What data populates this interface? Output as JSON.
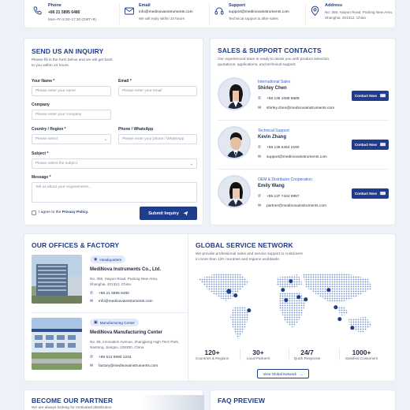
{
  "topbar": {
    "items": [
      {
        "icon": "phone-icon",
        "title": "Phone",
        "line1": "+86 21 5895 6480",
        "line2": "Mon–Fri 8:30–17:30 (GMT+8)"
      },
      {
        "icon": "mail-icon",
        "title": "Email",
        "line1": "info@medinovainstruments.com",
        "line2": "We will reply within 24 hours"
      },
      {
        "icon": "headset-icon",
        "title": "Support",
        "line1": "support@medinovainstruments.com",
        "line2": "Technical support & after-sales"
      },
      {
        "icon": "location-pin-icon",
        "title": "Address",
        "line1": "No. 355, Haiyun Road, Pudong New Area,",
        "line2": "Shanghai, 201312, China"
      }
    ]
  },
  "inquiry": {
    "title": "SEND US AN INQUIRY",
    "intro1": "Please fill in the form below and we will get back",
    "intro2": "to you within 24 hours.",
    "name_label": "Your Name *",
    "name_ph": "Please enter your name",
    "email_label": "Email *",
    "email_ph": "Please enter your email",
    "company_label": "Company",
    "company_ph": "Please enter your company",
    "country_label": "Country / Region *",
    "country_value": "Please select",
    "phone_label": "Phone / WhatsApp",
    "phone_ph": "Please enter your phone / WhatsApp",
    "subject_label": "Subject *",
    "subject_value": "Please select the subject",
    "message_label": "Message *",
    "message_ph": "Tell us about your requirements...",
    "agree_prefix": "I agree to the",
    "agree_link": "Privacy Policy.",
    "submit": "Submit Inquiry"
  },
  "contacts": {
    "title": "SALES & SUPPORT CONTACTS",
    "intro1": "Our experienced team is ready to assist you with product selection,",
    "intro2": "quotations, applications, and technical support.",
    "button": "Contact Now",
    "people": [
      {
        "role": "International Sales",
        "name": "Shirley Chen",
        "phone": "+86 138 1088 6688",
        "email": "shirley.chen@medinovainstruments.com"
      },
      {
        "role": "Technical Support",
        "name": "Kevin Zhang",
        "phone": "+86 135 6454 2190",
        "email": "support@medinovainstruments.com"
      },
      {
        "role": "OEM & Distributor Cooperation",
        "name": "Emily Wang",
        "phone": "+86 137 7444 9987",
        "email": "partner@medinovainstruments.com"
      }
    ]
  },
  "offices": {
    "title": "OUR OFFICES & FACTORY",
    "list": [
      {
        "badge": "Headquarters",
        "name": "MediNova Instruments Co., Ltd.",
        "addr1": "No. 355, Haiyun Road, Pudong New Area,",
        "addr2": "Shanghai, 201312, China",
        "phone": "+86 21 5895 6480",
        "email": "info@medinovainstruments.com"
      },
      {
        "badge": "Manufacturing Center",
        "name": "MediNova Manufacturing Center",
        "addr1": "No. 88, Innovation Avenue, Zhangjiang High-Tech Park,",
        "addr2": "Nantong, Jiangsu, 226300, China",
        "phone": "+86 513 8690 1234",
        "email": "factory@medinovainstruments.com"
      }
    ]
  },
  "network": {
    "title": "GLOBAL SERVICE NETWORK",
    "intro1": "We provide professional sales and service support to customers",
    "intro2": "in more than 120 countries and regions worldwide.",
    "stats": [
      {
        "value": "120+",
        "label": "Countries & Regions"
      },
      {
        "value": "30+",
        "label": "Local Partners"
      },
      {
        "value": "24/7",
        "label": "Quick Response"
      },
      {
        "value": "1000+",
        "label": "Satisfied Customers"
      }
    ],
    "button": "View Global Network"
  },
  "partner": {
    "title": "BECOME OUR PARTNER",
    "intro": "We are always looking for motivated distribution"
  },
  "faq": {
    "title": "FAQ PREVIEW"
  },
  "colors": {
    "navy": "#1f3d8c",
    "accent": "#3a5fcb",
    "bg": "#eef2f8"
  }
}
